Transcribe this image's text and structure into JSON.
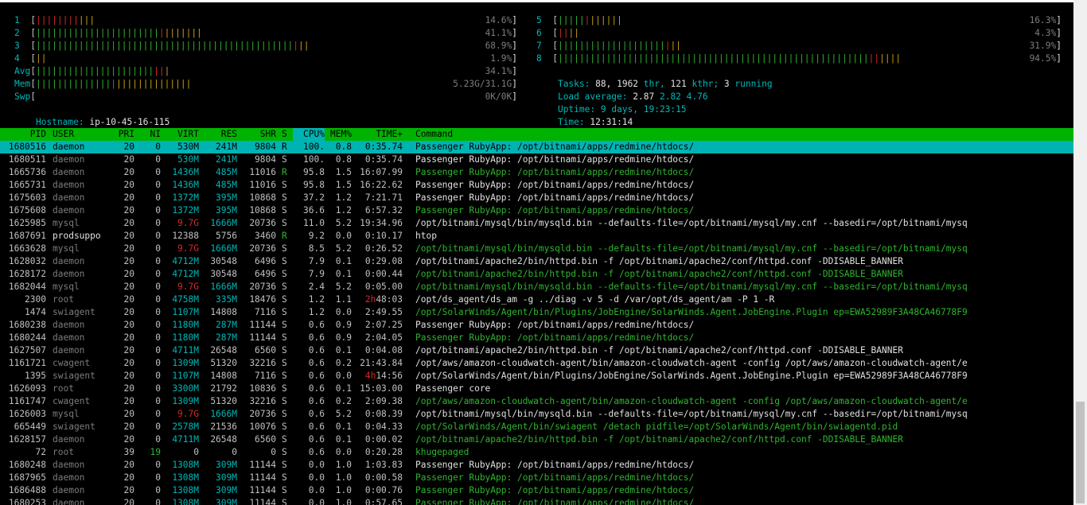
{
  "meters_left": [
    {
      "label": "1",
      "segments": [
        [
          "rd",
          "||||||||"
        ],
        [
          "ye",
          "|||"
        ]
      ],
      "value": "14.6%"
    },
    {
      "label": "2",
      "segments": [
        [
          "gn",
          "|||||||||||||||||||||||"
        ],
        [
          "rd",
          "|"
        ],
        [
          "ye",
          "|||||||"
        ]
      ],
      "value": "41.1%"
    },
    {
      "label": "3",
      "segments": [
        [
          "gn",
          "||||||||||||||||||||||||||||||||||||||||||||||||"
        ],
        [
          "rd",
          "|"
        ],
        [
          "ye",
          "||"
        ]
      ],
      "value": "68.9%"
    },
    {
      "label": "4",
      "segments": [
        [
          "ye",
          "||"
        ]
      ],
      "value": "1.9%"
    },
    {
      "label": "Avg",
      "segments": [
        [
          "gn",
          "||||||||||||||||||||||"
        ],
        [
          "rd",
          "||"
        ],
        [
          "ye",
          "|"
        ]
      ],
      "value": "34.1%"
    },
    {
      "label": "Mem",
      "segments": [
        [
          "gn",
          "||||||||||||||"
        ],
        [
          "bl",
          "|"
        ],
        [
          "ye",
          "||||||||||||||"
        ]
      ],
      "value": "5.23G/31.1G"
    },
    {
      "label": "Swp",
      "segments": [],
      "value": "0K/0K"
    }
  ],
  "meters_right": [
    {
      "label": "5",
      "segments": [
        [
          "gn",
          "|||||"
        ],
        [
          "rd",
          "|"
        ],
        [
          "ye",
          "||||||"
        ]
      ],
      "value": "16.3%"
    },
    {
      "label": "6",
      "segments": [
        [
          "rd",
          "||"
        ],
        [
          "ye",
          "||"
        ]
      ],
      "value": "4.3%"
    },
    {
      "label": "7",
      "segments": [
        [
          "gn",
          "||||||||||||||||||||"
        ],
        [
          "rd",
          "|"
        ],
        [
          "ye",
          "||"
        ]
      ],
      "value": "31.9%"
    },
    {
      "label": "8",
      "segments": [
        [
          "gn",
          "||||||||||||||||||||||||||||||||||||||||||||||||||||||||||"
        ],
        [
          "rd",
          "||"
        ],
        [
          "ye",
          "||||"
        ]
      ],
      "value": "94.5%"
    }
  ],
  "hostname": {
    "label": "Hostname:",
    "value": "ip-10-45-16-115"
  },
  "tasks": {
    "label": "Tasks:",
    "tasks": "88,",
    "thr": "1962",
    "thr_label": "thr,",
    "kthr": "121",
    "kthr_label": "kthr;",
    "running": "3",
    "running_label": "running"
  },
  "load": {
    "label": "Load average:",
    "l1": "2.87",
    "l5": "2.82",
    "l15": "4.76"
  },
  "uptime": {
    "label": "Uptime:",
    "value": "9 days, 19:23:15"
  },
  "time": {
    "label": "Time:",
    "value": "12:31:14"
  },
  "columns": [
    "PID",
    "USER",
    "PRI",
    "NI",
    "VIRT",
    "RES",
    "SHR",
    "S",
    "CPU%",
    "MEM%",
    "TIME+",
    "Command"
  ],
  "processes": [
    {
      "pid": "1680516",
      "user": "daemon",
      "pri": "20",
      "ni": "0",
      "virt": "530M",
      "res": "241M",
      "shr": "9804",
      "s": "R",
      "cpu": "100.",
      "mem": "0.8",
      "time": "0:35.74",
      "cmd": "Passenger RubyApp: /opt/bitnami/apps/redmine/htdocs/",
      "sel": true
    },
    {
      "pid": "1680511",
      "user": "daemon",
      "pri": "20",
      "ni": "0",
      "virt": "530M",
      "res": "241M",
      "shr": "9804",
      "s": "S",
      "cpu": "100.",
      "mem": "0.8",
      "time": "0:35.74",
      "cmd": "Passenger RubyApp: /opt/bitnami/apps/redmine/htdocs/"
    },
    {
      "pid": "1665736",
      "user": "daemon",
      "pri": "20",
      "ni": "0",
      "virt": "1436M",
      "res": "485M",
      "shr": "11016",
      "s": "R",
      "cpu": "95.8",
      "mem": "1.5",
      "time": "16:07.99",
      "cmd": "Passenger RubyApp: /opt/bitnami/apps/redmine/htdocs/",
      "thread": true
    },
    {
      "pid": "1665731",
      "user": "daemon",
      "pri": "20",
      "ni": "0",
      "virt": "1436M",
      "res": "485M",
      "shr": "11016",
      "s": "S",
      "cpu": "95.8",
      "mem": "1.5",
      "time": "16:22.62",
      "cmd": "Passenger RubyApp: /opt/bitnami/apps/redmine/htdocs/"
    },
    {
      "pid": "1675603",
      "user": "daemon",
      "pri": "20",
      "ni": "0",
      "virt": "1372M",
      "res": "395M",
      "shr": "10868",
      "s": "S",
      "cpu": "37.2",
      "mem": "1.2",
      "time": "7:21.71",
      "cmd": "Passenger RubyApp: /opt/bitnami/apps/redmine/htdocs/"
    },
    {
      "pid": "1675608",
      "user": "daemon",
      "pri": "20",
      "ni": "0",
      "virt": "1372M",
      "res": "395M",
      "shr": "10868",
      "s": "S",
      "cpu": "36.6",
      "mem": "1.2",
      "time": "6:57.32",
      "cmd": "Passenger RubyApp: /opt/bitnami/apps/redmine/htdocs/",
      "thread": true
    },
    {
      "pid": "1625985",
      "user": "mysql",
      "pri": "20",
      "ni": "0",
      "virt": "9.7G",
      "res": "1666M",
      "shr": "20736",
      "s": "S",
      "cpu": "11.0",
      "mem": "5.2",
      "time": "19:34.96",
      "cmd": "/opt/bitnami/mysql/bin/mysqld.bin --defaults-file=/opt/bitnami/mysql/my.cnf --basedir=/opt/bitnami/mysq"
    },
    {
      "pid": "1687691",
      "user": "prodsuppo",
      "pri": "20",
      "ni": "0",
      "virt": "12388",
      "res": "5756",
      "shr": "3460",
      "s": "R",
      "cpu": "9.2",
      "mem": "0.0",
      "time": "0:10.17",
      "cmd": "htop",
      "userwhite": true
    },
    {
      "pid": "1663628",
      "user": "mysql",
      "pri": "20",
      "ni": "0",
      "virt": "9.7G",
      "res": "1666M",
      "shr": "20736",
      "s": "S",
      "cpu": "8.5",
      "mem": "5.2",
      "time": "0:26.52",
      "cmd": "/opt/bitnami/mysql/bin/mysqld.bin --defaults-file=/opt/bitnami/mysql/my.cnf --basedir=/opt/bitnami/mysq",
      "thread": true
    },
    {
      "pid": "1628032",
      "user": "daemon",
      "pri": "20",
      "ni": "0",
      "virt": "4712M",
      "res": "30548",
      "shr": "6496",
      "s": "S",
      "cpu": "7.9",
      "mem": "0.1",
      "time": "0:29.08",
      "cmd": "/opt/bitnami/apache2/bin/httpd.bin -f /opt/bitnami/apache2/conf/httpd.conf -DDISABLE_BANNER"
    },
    {
      "pid": "1628172",
      "user": "daemon",
      "pri": "20",
      "ni": "0",
      "virt": "4712M",
      "res": "30548",
      "shr": "6496",
      "s": "S",
      "cpu": "7.9",
      "mem": "0.1",
      "time": "0:00.44",
      "cmd": "/opt/bitnami/apache2/bin/httpd.bin -f /opt/bitnami/apache2/conf/httpd.conf -DDISABLE_BANNER",
      "thread": true
    },
    {
      "pid": "1682044",
      "user": "mysql",
      "pri": "20",
      "ni": "0",
      "virt": "9.7G",
      "res": "1666M",
      "shr": "20736",
      "s": "S",
      "cpu": "2.4",
      "mem": "5.2",
      "time": "0:05.00",
      "cmd": "/opt/bitnami/mysql/bin/mysqld.bin --defaults-file=/opt/bitnami/mysql/my.cnf --basedir=/opt/bitnami/mysq",
      "thread": true
    },
    {
      "pid": "2300",
      "user": "root",
      "pri": "20",
      "ni": "0",
      "virt": "4758M",
      "res": "335M",
      "shr": "18476",
      "s": "S",
      "cpu": "1.2",
      "mem": "1.1",
      "time_h": "2h",
      "time": "48:03",
      "cmd": "/opt/ds_agent/ds_am -g ../diag -v 5 -d /var/opt/ds_agent/am -P 1 -R"
    },
    {
      "pid": "1474",
      "user": "swiagent",
      "pri": "20",
      "ni": "0",
      "virt": "1107M",
      "res": "14808",
      "shr": "7116",
      "s": "S",
      "cpu": "1.2",
      "mem": "0.0",
      "time": "2:49.55",
      "cmd": "/opt/SolarWinds/Agent/bin/Plugins/JobEngine/SolarWinds.Agent.JobEngine.Plugin ep=EWA52989F3A48CA46778F9",
      "thread": true
    },
    {
      "pid": "1680238",
      "user": "daemon",
      "pri": "20",
      "ni": "0",
      "virt": "1180M",
      "res": "287M",
      "shr": "11144",
      "s": "S",
      "cpu": "0.6",
      "mem": "0.9",
      "time": "2:07.25",
      "cmd": "Passenger RubyApp: /opt/bitnami/apps/redmine/htdocs/"
    },
    {
      "pid": "1680244",
      "user": "daemon",
      "pri": "20",
      "ni": "0",
      "virt": "1180M",
      "res": "287M",
      "shr": "11144",
      "s": "S",
      "cpu": "0.6",
      "mem": "0.9",
      "time": "2:04.05",
      "cmd": "Passenger RubyApp: /opt/bitnami/apps/redmine/htdocs/",
      "thread": true
    },
    {
      "pid": "1627507",
      "user": "daemon",
      "pri": "20",
      "ni": "0",
      "virt": "4711M",
      "res": "26548",
      "shr": "6560",
      "s": "S",
      "cpu": "0.6",
      "mem": "0.1",
      "time": "0:04.08",
      "cmd": "/opt/bitnami/apache2/bin/httpd.bin -f /opt/bitnami/apache2/conf/httpd.conf -DDISABLE_BANNER"
    },
    {
      "pid": "1161721",
      "user": "cwagent",
      "pri": "20",
      "ni": "0",
      "virt": "1309M",
      "res": "51320",
      "shr": "32216",
      "s": "S",
      "cpu": "0.6",
      "mem": "0.2",
      "time": "21:43.84",
      "cmd": "/opt/aws/amazon-cloudwatch-agent/bin/amazon-cloudwatch-agent -config /opt/aws/amazon-cloudwatch-agent/e"
    },
    {
      "pid": "1395",
      "user": "swiagent",
      "pri": "20",
      "ni": "0",
      "virt": "1107M",
      "res": "14808",
      "shr": "7116",
      "s": "S",
      "cpu": "0.6",
      "mem": "0.0",
      "time_h": "4h",
      "time": "14:56",
      "cmd": "/opt/SolarWinds/Agent/bin/Plugins/JobEngine/SolarWinds.Agent.JobEngine.Plugin ep=EWA52989F3A48CA46778F9"
    },
    {
      "pid": "1626093",
      "user": "root",
      "pri": "20",
      "ni": "0",
      "virt": "3300M",
      "res": "21792",
      "shr": "10836",
      "s": "S",
      "cpu": "0.6",
      "mem": "0.1",
      "time": "15:03.00",
      "cmd": "Passenger core"
    },
    {
      "pid": "1161747",
      "user": "cwagent",
      "pri": "20",
      "ni": "0",
      "virt": "1309M",
      "res": "51320",
      "shr": "32216",
      "s": "S",
      "cpu": "0.6",
      "mem": "0.2",
      "time": "2:09.38",
      "cmd": "/opt/aws/amazon-cloudwatch-agent/bin/amazon-cloudwatch-agent -config /opt/aws/amazon-cloudwatch-agent/e",
      "thread": true
    },
    {
      "pid": "1626003",
      "user": "mysql",
      "pri": "20",
      "ni": "0",
      "virt": "9.7G",
      "res": "1666M",
      "shr": "20736",
      "s": "S",
      "cpu": "0.6",
      "mem": "5.2",
      "time": "0:08.39",
      "cmd": "/opt/bitnami/mysql/bin/mysqld.bin --defaults-file=/opt/bitnami/mysql/my.cnf --basedir=/opt/bitnami/mysq"
    },
    {
      "pid": "665449",
      "user": "swiagent",
      "pri": "20",
      "ni": "0",
      "virt": "2578M",
      "res": "21536",
      "shr": "10076",
      "s": "S",
      "cpu": "0.6",
      "mem": "0.1",
      "time": "0:04.33",
      "cmd": "/opt/SolarWinds/Agent/bin/swiagent /detach pidfile=/opt/SolarWinds/Agent/bin/swiagentd.pid",
      "thread": true
    },
    {
      "pid": "1628157",
      "user": "daemon",
      "pri": "20",
      "ni": "0",
      "virt": "4711M",
      "res": "26548",
      "shr": "6560",
      "s": "S",
      "cpu": "0.6",
      "mem": "0.1",
      "time": "0:00.02",
      "cmd": "/opt/bitnami/apache2/bin/httpd.bin -f /opt/bitnami/apache2/conf/httpd.conf -DDISABLE_BANNER",
      "thread": true
    },
    {
      "pid": "72",
      "user": "root",
      "pri": "39",
      "ni": "19",
      "virt": "0",
      "res": "0",
      "shr": "0",
      "s": "S",
      "cpu": "0.6",
      "mem": "0.0",
      "time": "0:20.28",
      "cmd": "khugepaged",
      "kernel": true
    },
    {
      "pid": "1680248",
      "user": "daemon",
      "pri": "20",
      "ni": "0",
      "virt": "1308M",
      "res": "309M",
      "shr": "11144",
      "s": "S",
      "cpu": "0.0",
      "mem": "1.0",
      "time": "1:03.83",
      "cmd": "Passenger RubyApp: /opt/bitnami/apps/redmine/htdocs/"
    },
    {
      "pid": "1687965",
      "user": "daemon",
      "pri": "20",
      "ni": "0",
      "virt": "1308M",
      "res": "309M",
      "shr": "11144",
      "s": "S",
      "cpu": "0.0",
      "mem": "1.0",
      "time": "0:00.58",
      "cmd": "Passenger RubyApp: /opt/bitnami/apps/redmine/htdocs/",
      "thread": true
    },
    {
      "pid": "1686488",
      "user": "daemon",
      "pri": "20",
      "ni": "0",
      "virt": "1308M",
      "res": "309M",
      "shr": "11144",
      "s": "S",
      "cpu": "0.0",
      "mem": "1.0",
      "time": "0:00.76",
      "cmd": "Passenger RubyApp: /opt/bitnami/apps/redmine/htdocs/",
      "thread": true
    },
    {
      "pid": "1680253",
      "user": "daemon",
      "pri": "20",
      "ni": "0",
      "virt": "1308M",
      "res": "309M",
      "shr": "11144",
      "s": "S",
      "cpu": "0.0",
      "mem": "1.0",
      "time": "0:57.65",
      "cmd": "Passenger RubyApp: /opt/bitnami/apps/redmine/htdocs/",
      "thread": true
    }
  ]
}
